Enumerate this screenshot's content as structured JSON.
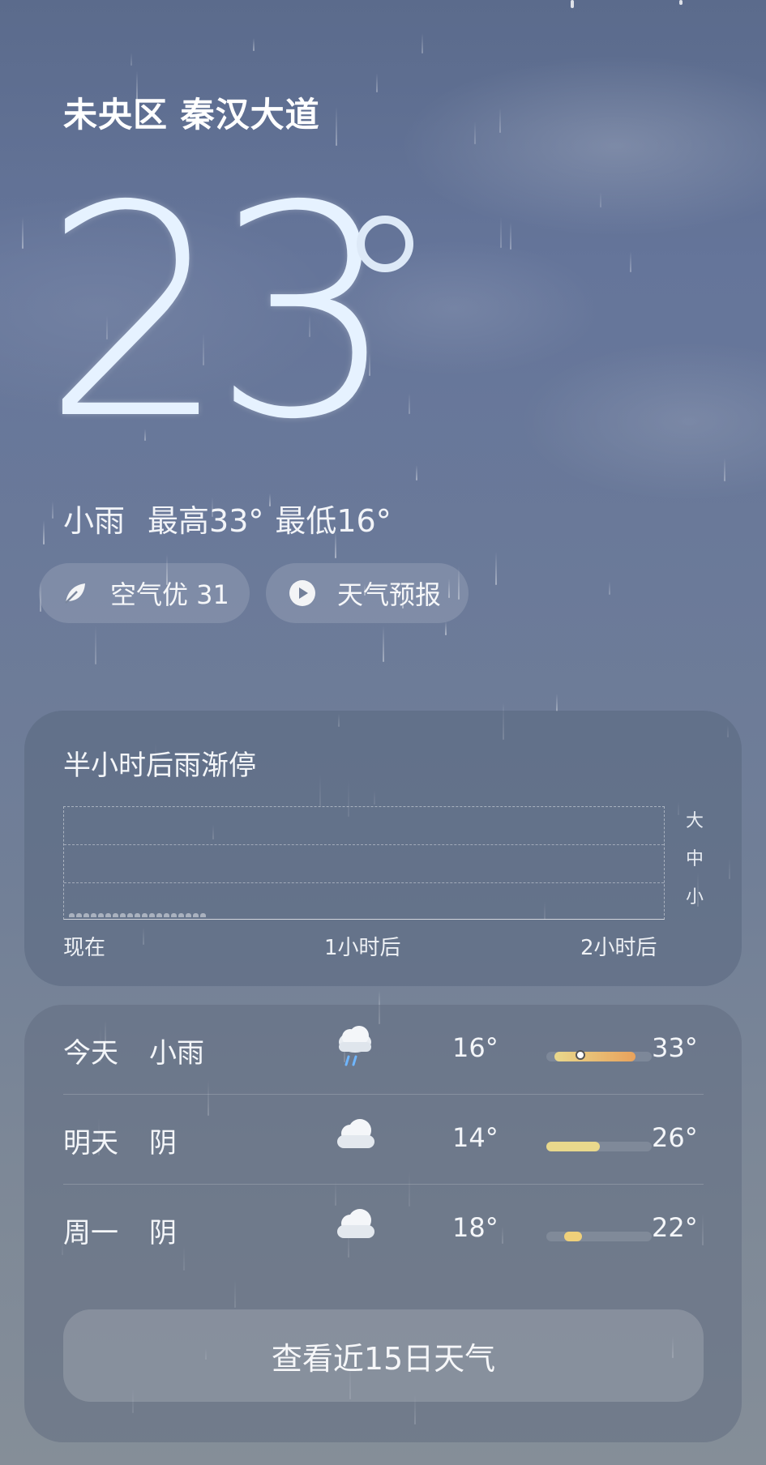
{
  "header": {
    "location": "未央区 秦汉大道"
  },
  "current": {
    "temperature": "23",
    "condition": "小雨",
    "high": "最高33°",
    "low": "最低16°"
  },
  "pills": {
    "air_quality": "空气优 31",
    "forecast_video": "天气预报"
  },
  "rain_card": {
    "title": "半小时后雨渐停",
    "y_levels": [
      "大",
      "中",
      "小"
    ],
    "x_labels": [
      "现在",
      "1小时后",
      "2小时后"
    ]
  },
  "daily": [
    {
      "day": "今天",
      "condition": "小雨",
      "icon": "cloud-rain-icon",
      "low": "16°",
      "high": "33°",
      "range_min": 16,
      "range_max": 33,
      "current": 23
    },
    {
      "day": "明天",
      "condition": "阴",
      "icon": "cloud-icon",
      "low": "14°",
      "high": "26°",
      "range_min": 14,
      "range_max": 26
    },
    {
      "day": "周一",
      "condition": "阴",
      "icon": "cloud-icon",
      "low": "18°",
      "high": "22°",
      "range_min": 18,
      "range_max": 22
    }
  ],
  "view_15_days": "查看近15日天气",
  "colors": {
    "sky_top": "#5b6b8c",
    "sky_bottom": "#858e98",
    "warm_bar": "#e8a25c",
    "mild_bar": "#e9d88c"
  }
}
